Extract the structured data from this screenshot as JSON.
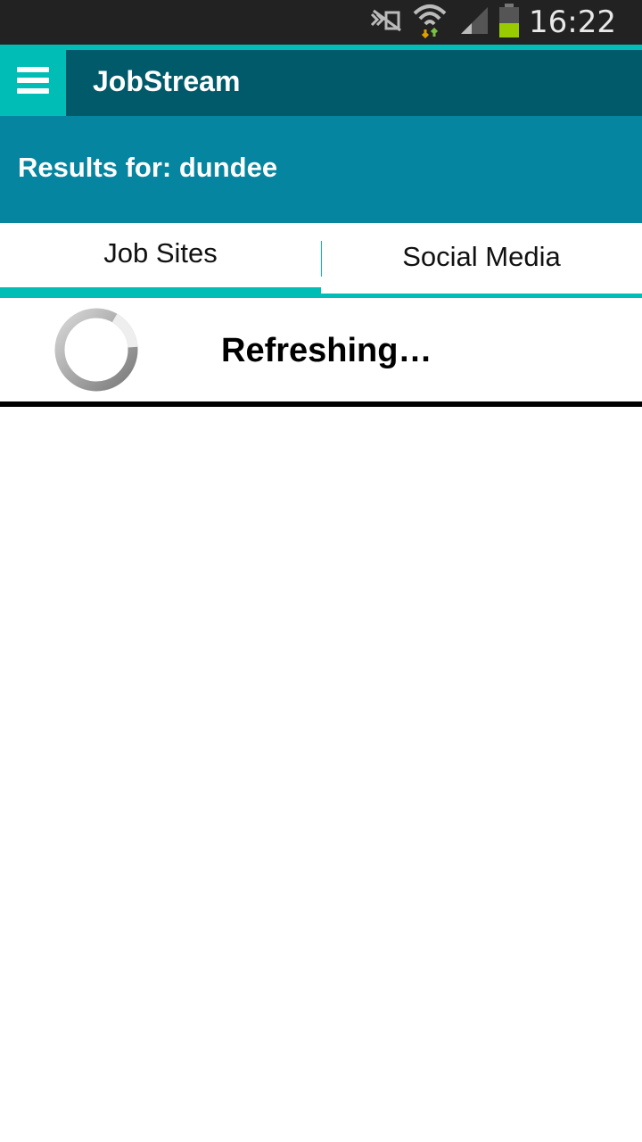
{
  "status_bar": {
    "time": "16:22",
    "icons": [
      "silent-mode-icon",
      "wifi-icon",
      "signal-icon",
      "battery-icon"
    ]
  },
  "app_bar": {
    "title": "JobStream",
    "menu_icon": "hamburger-menu-icon"
  },
  "results": {
    "label": "Results for: dundee"
  },
  "tabs": [
    {
      "label": "Job Sites",
      "active": true
    },
    {
      "label": "Social Media",
      "active": false
    }
  ],
  "refresh": {
    "text": "Refreshing…",
    "icon": "loading-spinner-icon"
  },
  "colors": {
    "accent": "#00bdb6",
    "app_bar": "#005a6a",
    "banner": "#05859f",
    "status_bar": "#222222"
  }
}
